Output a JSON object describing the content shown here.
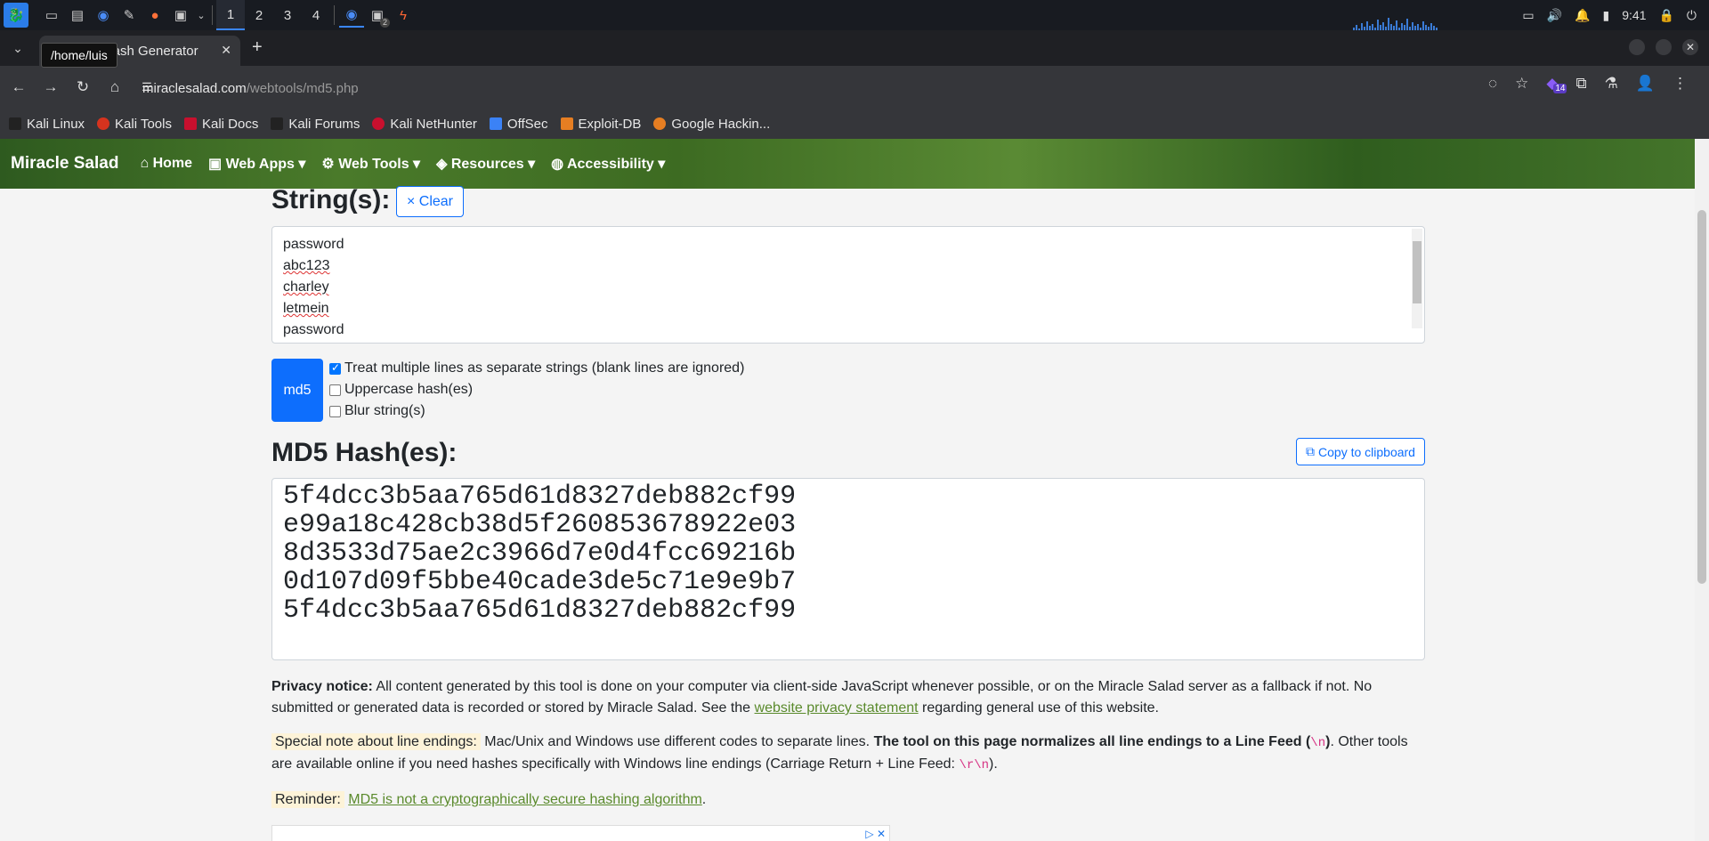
{
  "taskbar": {
    "workspaces": [
      "1",
      "2",
      "3",
      "4"
    ],
    "terminal_badge": "2",
    "clock": "9:41"
  },
  "browser": {
    "tab_title": "MD5 Hash Generator",
    "tooltip": "/home/luis",
    "url_host": "miraclesalad.com",
    "url_path": "/webtools/md5.php",
    "extension_badge": "14",
    "bookmarks": [
      {
        "label": "Kali Linux",
        "color": "#222"
      },
      {
        "label": "Kali Tools",
        "color": "#d6331e"
      },
      {
        "label": "Kali Docs",
        "color": "#c8102e"
      },
      {
        "label": "Kali Forums",
        "color": "#222"
      },
      {
        "label": "Kali NetHunter",
        "color": "#c8102e"
      },
      {
        "label": "OffSec",
        "color": "#3b82f6"
      },
      {
        "label": "Exploit-DB",
        "color": "#e67e22"
      },
      {
        "label": "Google Hackin...",
        "color": "#e67e22"
      }
    ]
  },
  "site": {
    "brand": "Miracle Salad",
    "menu": [
      "Home",
      "Web Apps",
      "Web Tools",
      "Resources",
      "Accessibility"
    ]
  },
  "tool": {
    "strings_heading": "String(s):",
    "clear_label": "× Clear",
    "input_lines": [
      "password",
      "abc123",
      "charley",
      "letmein",
      "password"
    ],
    "md5_button": "md5",
    "options": [
      {
        "label": "Treat multiple lines as separate strings (blank lines are ignored)",
        "checked": true
      },
      {
        "label": "Uppercase hash(es)",
        "checked": false
      },
      {
        "label": "Blur string(s)",
        "checked": false
      }
    ],
    "hash_heading": "MD5 Hash(es):",
    "copy_label": "Copy to clipboard",
    "hashes": [
      "5f4dcc3b5aa765d61d8327deb882cf99",
      "e99a18c428cb38d5f260853678922e03",
      "8d3533d75ae2c3966d7e0d4fcc69216b",
      "0d107d09f5bbe40cade3de5c71e9e9b7",
      "5f4dcc3b5aa765d61d8327deb882cf99"
    ]
  },
  "notices": {
    "privacy_label": "Privacy notice:",
    "privacy_text_1": "All content generated by this tool is done on your computer via client-side JavaScript whenever possible, or on the Miracle Salad server as a fallback if not. No submitted or generated data is recorded or stored by Miracle Salad. See the ",
    "privacy_link": "website privacy statement",
    "privacy_text_2": " regarding general use of this website.",
    "line_endings_label": "Special note about line endings:",
    "line_endings_text_1": " Mac/Unix and Windows use different codes to separate lines. ",
    "line_endings_bold": "The tool on this page normalizes all line endings to a Line Feed (",
    "line_endings_code": "\\n",
    "line_endings_bold_end": ")",
    "line_endings_text_2": ". Other tools are available online if you need hashes specifically with Windows line endings (Carriage Return + Line Feed: ",
    "line_endings_code_2": "\\r\\n",
    "line_endings_text_3": ").",
    "reminder_label": "Reminder:",
    "reminder_link": "MD5 is not a cryptographically secure hashing algorithm",
    "reminder_end": "."
  }
}
